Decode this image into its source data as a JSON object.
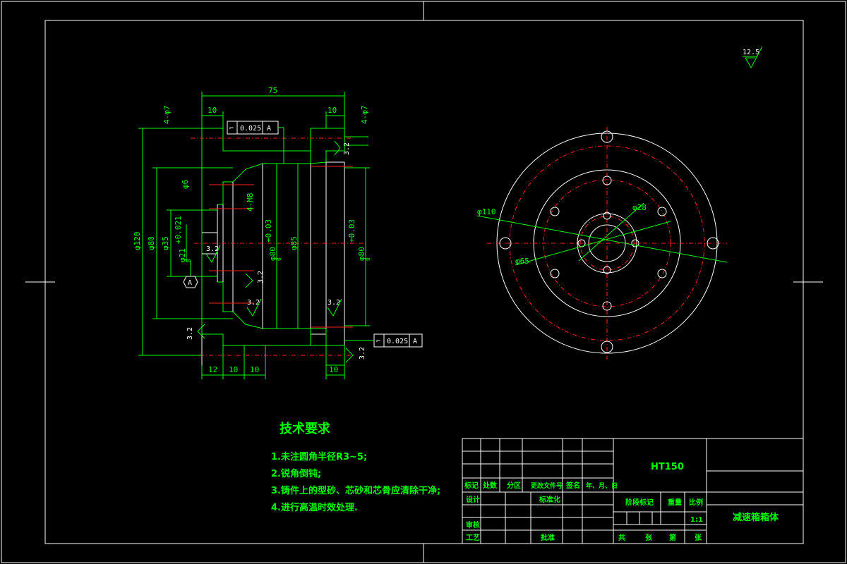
{
  "drawing": {
    "material": "HT150",
    "part_name": "减速箱箱体",
    "scale": "1:1",
    "surface_roughness_general": "12.5"
  },
  "tech_requirements": {
    "title": "技术要求",
    "items": [
      "1.未注圆角半径R3~5;",
      "2.锐角倒钝;",
      "3.铸件上的型砂、芯砂和芯骨应清除干净;",
      "4.进行高温时效处理."
    ]
  },
  "section_view": {
    "dims": {
      "overall_length": "75",
      "flange_left": "10",
      "flange_right": "10",
      "holes_left": "4-φ7",
      "holes_right": "4-φ7",
      "dia_120": "φ120",
      "dia_80": "φ80",
      "dia_35": "φ35",
      "dia_21": "φ21",
      "dia_21_tol": "+0.021",
      "dia_21_sub": "0",
      "dia_6": "φ6",
      "thread_m8": "4-M8",
      "bore_80_left": "φ80",
      "bore_80_left_tol": "+0.03",
      "bore_80_left_sub": "0",
      "dia_85": "φ85",
      "bore_80_right": "φ80",
      "bore_80_right_tol": "+0.03",
      "bore_80_right_sub": "0",
      "bottom_12": "12",
      "bottom_10a": "10",
      "bottom_10b": "10",
      "bottom_10c": "10"
    },
    "tolerance_frames": [
      {
        "symbol": "⌐",
        "value": "0.025",
        "datum": "A"
      },
      {
        "symbol": "⌐",
        "value": "0.025",
        "datum": "A"
      }
    ],
    "datum_label": "A",
    "roughness": [
      "3.2",
      "3.2",
      "3.2",
      "3.2",
      "3.2",
      "3.2",
      "3.2"
    ]
  },
  "end_view": {
    "dims": {
      "dia_110": "φ110",
      "dia_65": "φ65",
      "dia_28": "φ28"
    }
  },
  "title_block": {
    "row_labels": [
      "标记",
      "处数",
      "分区",
      "更改文件号",
      "签名",
      "年、月、日"
    ],
    "design": "设计",
    "standardize": "标准化",
    "review": "审核",
    "process": "工艺",
    "approve": "批准",
    "stage_mark": "阶段标记",
    "weight": "重量",
    "scale_label": "比例",
    "total": "共",
    "sheets": "张",
    "no": "第",
    "sheet": "张"
  },
  "colors": {
    "background": "#000000",
    "line_primary": "#00ff00",
    "line_outline": "#ffffff",
    "centerline": "#ff2020"
  }
}
